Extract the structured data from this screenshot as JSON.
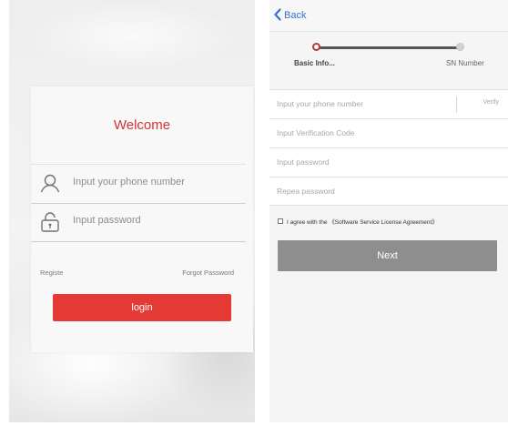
{
  "login": {
    "title": "Welcome",
    "phone_placeholder": "Input your phone number",
    "password_placeholder": "Input password",
    "register_link": "Registe",
    "forgot_link": "Forgot Password",
    "login_button": "login",
    "icons": {
      "phone": "user-icon",
      "password": "lock-icon"
    },
    "colors": {
      "title": "#d23535",
      "button": "#e53935"
    }
  },
  "register": {
    "back_label": "Back",
    "steps": [
      {
        "label": "Basic Info..."
      },
      {
        "label": "SN Number"
      }
    ],
    "fields": {
      "phone": "Input your phone number",
      "verify_label": "Verify",
      "verification_code": "Input Verification Code",
      "password": "Input password",
      "repeat_password": "Repea password"
    },
    "agreement": "I agree with the 《Software Service License Agreement》",
    "next_button": "Next",
    "icons": {
      "back": "chevron-left-icon",
      "checkbox": "checkbox-icon"
    },
    "colors": {
      "back": "#3474ce",
      "next_button": "#8e8e8e",
      "active_step": "#b33a3a"
    }
  }
}
